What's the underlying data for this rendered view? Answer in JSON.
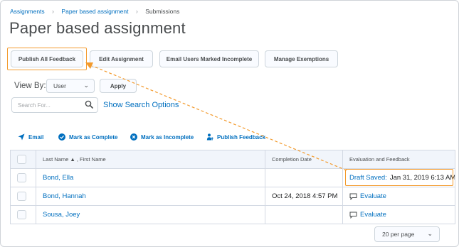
{
  "breadcrumb": {
    "items": [
      "Assignments",
      "Paper based assignment",
      "Submissions"
    ]
  },
  "page": {
    "title": "Paper based assignment"
  },
  "toolbar": {
    "publish_all": "Publish All Feedback",
    "edit_assignment": "Edit Assignment",
    "email_incomplete": "Email Users Marked Incomplete",
    "manage_exemptions": "Manage Exemptions"
  },
  "view": {
    "label": "View By:",
    "selected": "User",
    "apply": "Apply"
  },
  "search": {
    "placeholder": "Search For...",
    "options_link": "Show Search Options"
  },
  "actions": [
    {
      "label": "Email",
      "icon": "send-icon"
    },
    {
      "label": "Mark as Complete",
      "icon": "check-circle-icon"
    },
    {
      "label": "Mark as Incomplete",
      "icon": "x-circle-icon"
    },
    {
      "label": "Publish Feedback",
      "icon": "publish-user-icon"
    }
  ],
  "table": {
    "headers": {
      "name": "Last Name ▲ , First Name",
      "completion": "Completion Date",
      "evaluation": "Evaluation and Feedback"
    },
    "rows": [
      {
        "name": "Bond, Ella",
        "completion": "",
        "eval_link": "Draft Saved:",
        "eval_text": "Jan 31, 2019 6:13 AM"
      },
      {
        "name": "Bond, Hannah",
        "completion": "Oct 24, 2018 4:57 PM",
        "eval_link": "Evaluate",
        "eval_text": ""
      },
      {
        "name": "Sousa, Joey",
        "completion": "",
        "eval_link": "Evaluate",
        "eval_text": ""
      }
    ]
  },
  "pager": {
    "selected": "20 per page"
  },
  "colors": {
    "link": "#006fbf",
    "highlight": "#f39a2c",
    "header_bg": "#f1f5fb",
    "text": "#494c4e"
  }
}
